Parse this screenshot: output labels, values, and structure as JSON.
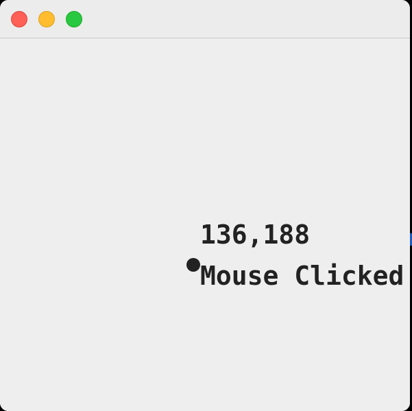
{
  "window": {
    "controls": {
      "close": "close",
      "minimize": "minimize",
      "zoom": "zoom"
    },
    "colors": {
      "close": "#fe5f57",
      "minimize": "#febc2e",
      "zoom": "#28c840",
      "background": "#eeeeee",
      "text": "#222222"
    }
  },
  "canvas": {
    "coordinates_text": "136,188",
    "event_text": "Mouse Clicked"
  }
}
